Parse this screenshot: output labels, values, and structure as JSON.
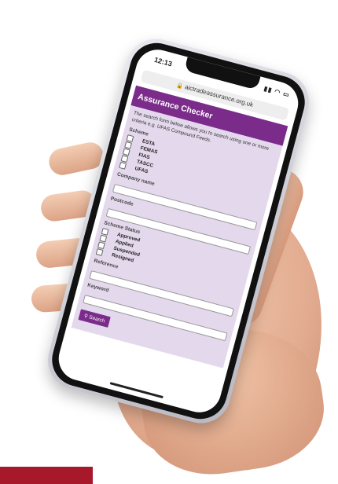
{
  "status_bar": {
    "time": "12:13",
    "icons": "▮▮ ◠ ▭"
  },
  "browser": {
    "url": "aictradeassurance.org.uk"
  },
  "page": {
    "title": "Assurance Checker",
    "intro": "The search form below allows you to search using one or more criteria e.g. UFAS Compound Feeds.",
    "scheme": {
      "label": "Scheme",
      "options": [
        "ESTA",
        "FEMAS",
        "FIAS",
        "TASCC",
        "UFAS"
      ]
    },
    "company_name": {
      "label": "Company name",
      "value": ""
    },
    "postcode": {
      "label": "Postcode",
      "value": ""
    },
    "scheme_status": {
      "label": "Scheme Status",
      "options": [
        "Approved",
        "Applied",
        "Suspended",
        "Resigned"
      ]
    },
    "reference": {
      "label": "Reference",
      "value": ""
    },
    "keyword": {
      "label": "Keyword",
      "value": ""
    },
    "search_button": {
      "label": "Search"
    }
  },
  "colors": {
    "brand_purple": "#7b2c8b",
    "form_bg": "#e4d9ec",
    "accent_red": "#a8182b"
  }
}
